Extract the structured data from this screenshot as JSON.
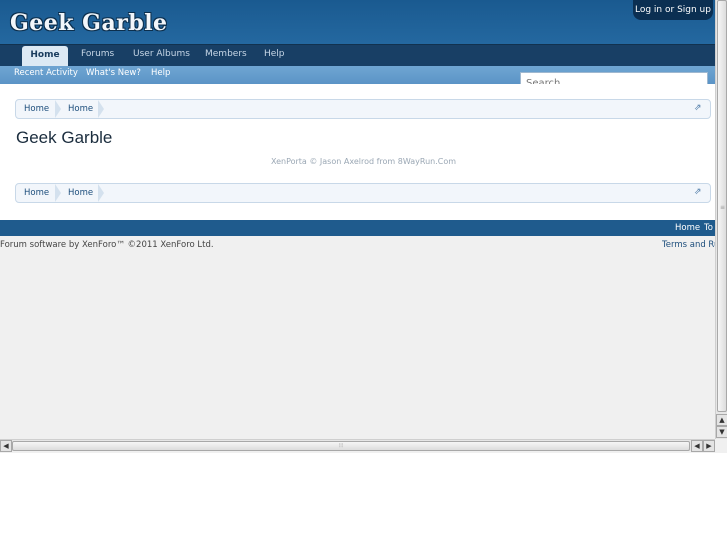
{
  "header": {
    "logo": "Geek Garble",
    "login": "Log in or Sign up"
  },
  "nav": {
    "tabs": [
      "Home",
      "Forums",
      "User Albums",
      "Members",
      "Help"
    ]
  },
  "subnav": {
    "items": [
      "Recent Activity",
      "What's New?",
      "Help"
    ]
  },
  "search": {
    "placeholder": "Search..."
  },
  "breadcrumb": {
    "items": [
      "Home",
      "Home"
    ]
  },
  "main": {
    "title": "Geek Garble",
    "credit": "XenPorta © Jason Axelrod from 8WayRun.Com"
  },
  "footer": {
    "links": [
      "Home",
      "To"
    ],
    "copyright": "Forum software by XenForo™ ©2011 XenForo Ltd.",
    "terms": "Terms and Ru"
  },
  "colors": {
    "header_blue": "#1f5b8d",
    "nav_dark": "#183f65",
    "subnav_blue": "#6fa5d2",
    "link_blue": "#1d4e7c"
  }
}
